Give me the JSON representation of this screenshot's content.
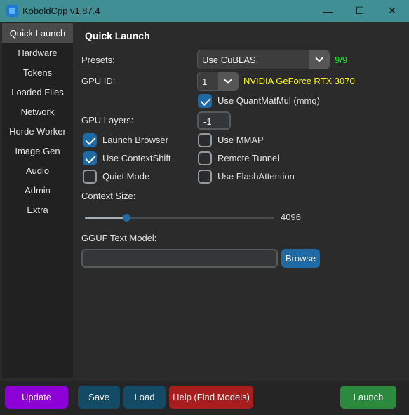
{
  "window": {
    "title": "KoboldCpp v1.87.4",
    "minimize": "—",
    "maximize": "☐",
    "close": "✕"
  },
  "sidebar": {
    "items": [
      {
        "label": "Quick Launch"
      },
      {
        "label": "Hardware"
      },
      {
        "label": "Tokens"
      },
      {
        "label": "Loaded Files"
      },
      {
        "label": "Network"
      },
      {
        "label": "Horde Worker"
      },
      {
        "label": "Image Gen"
      },
      {
        "label": "Audio"
      },
      {
        "label": "Admin"
      },
      {
        "label": "Extra"
      }
    ],
    "active": "Quick Launch"
  },
  "main": {
    "heading": "Quick Launch",
    "presets_label": "Presets:",
    "presets_value": "Use CuBLAS",
    "presets_count": "9/9",
    "gpu_id_label": "GPU ID:",
    "gpu_id_value": "1",
    "gpu_name": "NVIDIA GeForce RTX 3070",
    "quantmatmul_label": "Use QuantMatMul (mmq)",
    "quantmatmul_checked": true,
    "gpu_layers_label": "GPU Layers:",
    "gpu_layers_value": "-1",
    "checkboxes": {
      "launch_browser": {
        "label": "Launch Browser",
        "checked": true
      },
      "use_mmap": {
        "label": "Use MMAP",
        "checked": false
      },
      "use_contextshift": {
        "label": "Use ContextShift",
        "checked": true
      },
      "remote_tunnel": {
        "label": "Remote Tunnel",
        "checked": false
      },
      "quiet_mode": {
        "label": "Quiet Mode",
        "checked": false
      },
      "use_flashattention": {
        "label": "Use FlashAttention",
        "checked": false
      }
    },
    "context_size_label": "Context Size:",
    "context_size_value": "4096",
    "context_slider_fraction": 0.22,
    "model_label": "GGUF Text Model:",
    "model_value": "",
    "browse_label": "Browse"
  },
  "footer": {
    "update": "Update",
    "save": "Save",
    "load": "Load",
    "help": "Help (Find Models)",
    "launch": "Launch"
  },
  "colors": {
    "titlebar": "#3f8f95",
    "accent": "#1f6aa5",
    "gpu_name": "#ffff00",
    "count": "#00ff00",
    "update_button": "#8d00d6",
    "save_load_button": "#134a66",
    "help_button": "#a61e1e",
    "launch_button": "#2b8a3e"
  }
}
